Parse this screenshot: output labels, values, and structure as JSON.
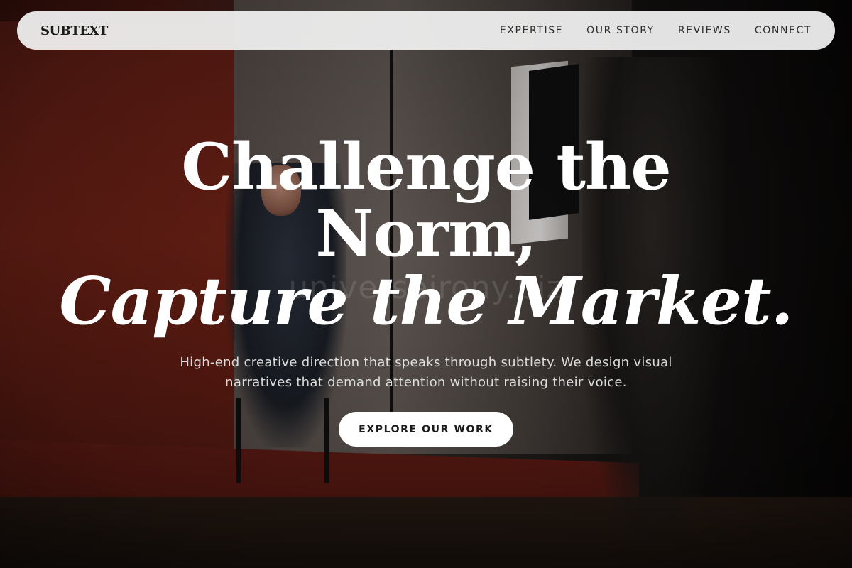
{
  "brand": {
    "logo": "SUBTEXT"
  },
  "nav": {
    "links": [
      {
        "label": "EXPERTISE"
      },
      {
        "label": "OUR STORY"
      },
      {
        "label": "REVIEWS"
      },
      {
        "label": "CONNECT"
      }
    ]
  },
  "hero": {
    "headline_line1": "Challenge the",
    "headline_line2": "Norm,",
    "headline_line3": "Capture the Market.",
    "subcopy": "High-end creative direction that speaks through subtlety. We design visual narratives that demand attention without raising their voice.",
    "cta_label": "EXPLORE OUR WORK",
    "watermark": "universeirony.biz"
  },
  "colors": {
    "nav_bg": "#f0f0f0",
    "text_light": "#ffffff",
    "backdrop_red": "#7a2518",
    "cta_bg": "#ffffff"
  }
}
